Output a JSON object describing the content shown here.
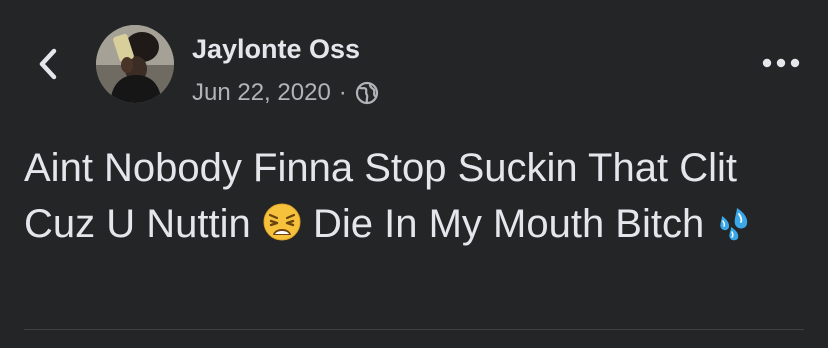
{
  "post": {
    "author": "Jaylonte Oss",
    "date": "Jun 22, 2020",
    "separator": "·",
    "privacy_icon": "globe-icon",
    "text_part1": "Aint Nobody Finna Stop Suckin That Clit Cuz U Nuttin ",
    "emoji1": "weary-face-emoji",
    "text_part2": " Die In My Mouth Bitch ",
    "emoji2": "sweat-droplets-emoji"
  },
  "icons": {
    "back": "chevron-left-icon",
    "more": "more-horizontal-icon"
  },
  "colors": {
    "background": "#242526",
    "primary_text": "#e4e6eb",
    "secondary_text": "#b0b3b8",
    "emoji_face": "#f7c23b",
    "emoji_droplets": "#3aa8e8"
  }
}
